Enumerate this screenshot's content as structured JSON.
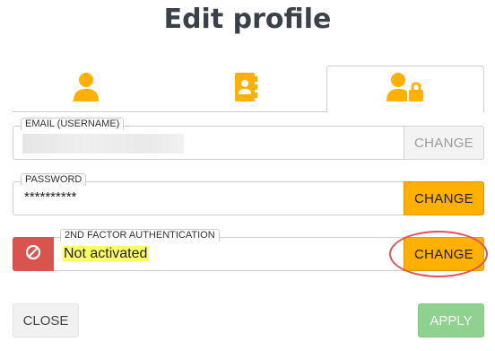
{
  "dialog": {
    "title": "Edit profile"
  },
  "tabs": [
    {
      "icon": "user-icon"
    },
    {
      "icon": "contact-book-icon"
    },
    {
      "icon": "user-lock-icon",
      "selected": true
    }
  ],
  "email": {
    "legend": "EMAIL (USERNAME)",
    "button": "CHANGE"
  },
  "password": {
    "legend": "PASSWORD",
    "value": "**********",
    "button": "CHANGE"
  },
  "twofa": {
    "legend": "2ND FACTOR AUTHENTICATION",
    "status": "Not activated",
    "button": "CHANGE",
    "icon": "ban-icon"
  },
  "footer": {
    "close": "CLOSE",
    "apply": "APPLY"
  },
  "colors": {
    "accent": "#ffb000",
    "danger": "#d9534f",
    "apply": "#8fd18f",
    "highlight": "#ffff66",
    "annotation": "#e0555a"
  }
}
